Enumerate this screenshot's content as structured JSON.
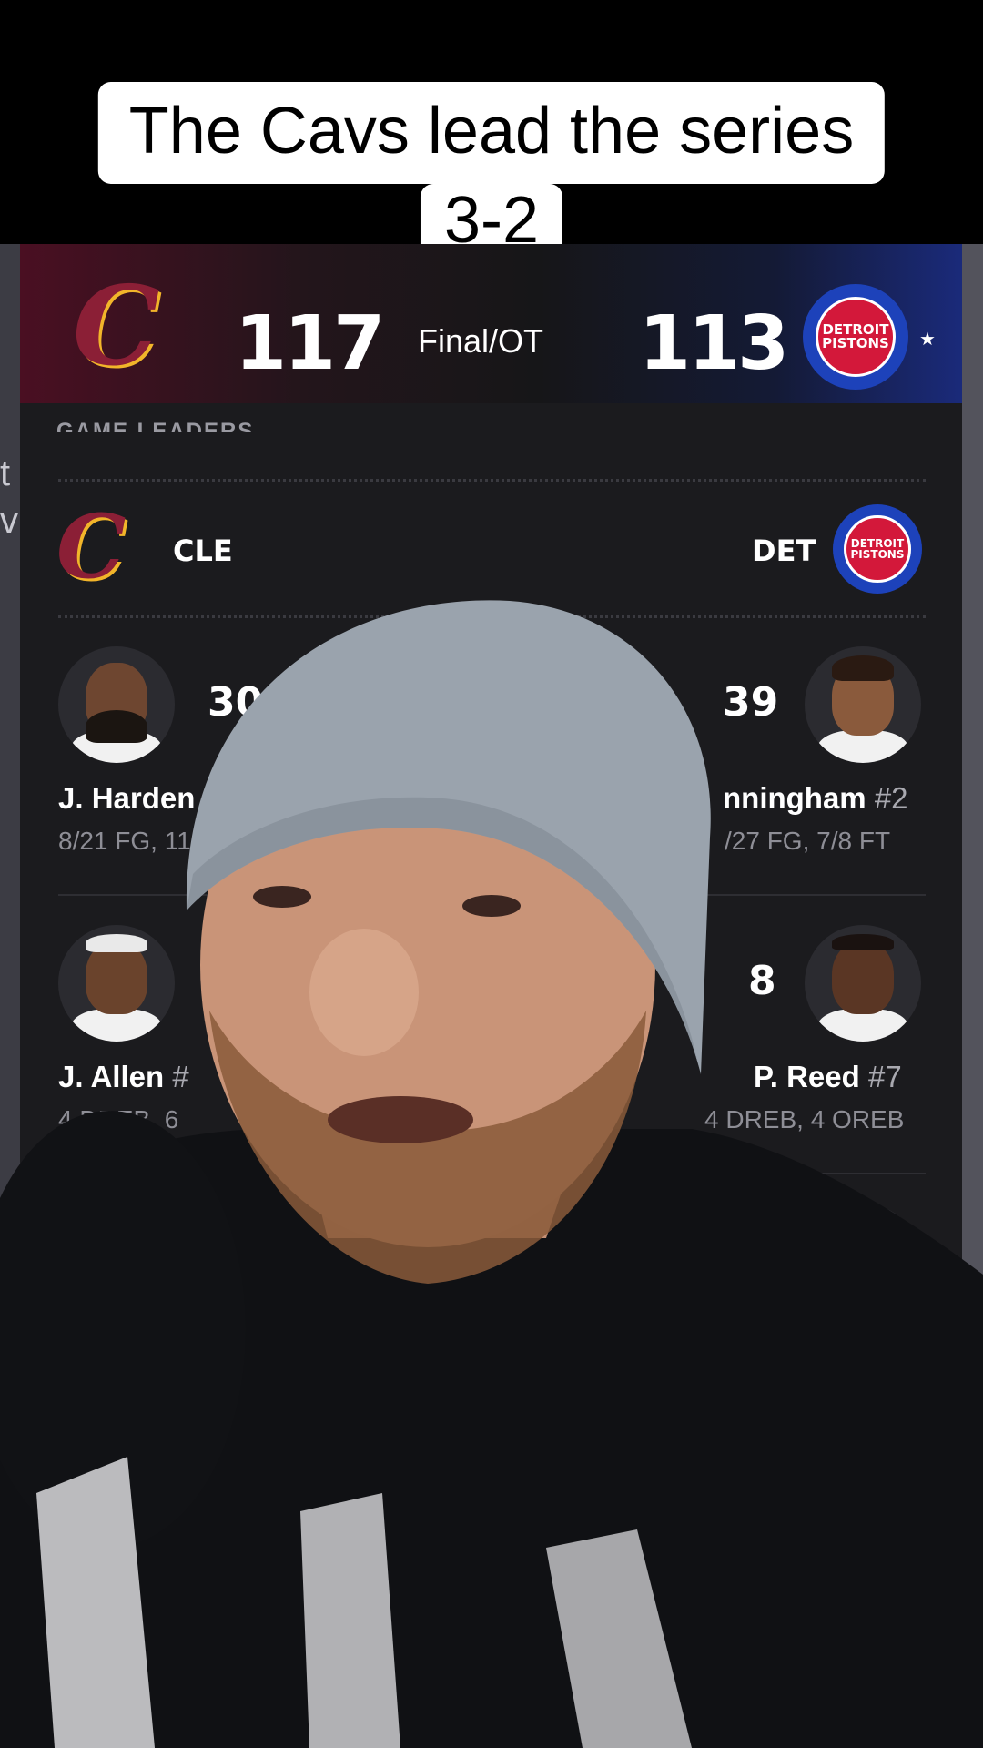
{
  "caption": {
    "line1": "The Cavs lead the series",
    "line2": "3-2"
  },
  "background_app": {
    "left_text_1": "t",
    "left_text_2": "v"
  },
  "scoreboard": {
    "home_logo_letter": "C",
    "home_score": "117",
    "status": "Final/OT",
    "away_score": "113",
    "away_logo_text_1": "DETROIT",
    "away_logo_text_2": "PISTONS",
    "star": "★"
  },
  "game_leaders": {
    "section_title": "GAME LEADERS",
    "home_abbr": "CLE",
    "away_abbr": "DET",
    "rows": [
      {
        "home_stat": "30",
        "home_name": "J. Harden",
        "home_line": "8/21 FG, 11/",
        "away_stat": "39",
        "away_name": "nningham",
        "away_num": "#2",
        "away_line": "/27 FG, 7/8 FT"
      },
      {
        "home_stat": "",
        "home_name": "J. Allen",
        "home_num": "#",
        "home_line": "4 DREB, 6",
        "away_stat": "8",
        "away_name": "P. Reed",
        "away_num": "#7",
        "away_line": "4 DREB, 4 OREB"
      },
      {
        "away_stat_partial": ""
      }
    ]
  },
  "colors": {
    "panel_bg": "#1b1b1e",
    "cavs_wine": "#8b1f36",
    "cavs_gold": "#f2b52a",
    "pistons_red": "#d3183a",
    "pistons_blue": "#1d42ba",
    "hoodie": "#101114",
    "beanie": "#9aa3ad"
  },
  "icons": [
    "cavaliers-logo-icon",
    "pistons-logo-icon",
    "player-avatar-icon",
    "star-icon"
  ]
}
